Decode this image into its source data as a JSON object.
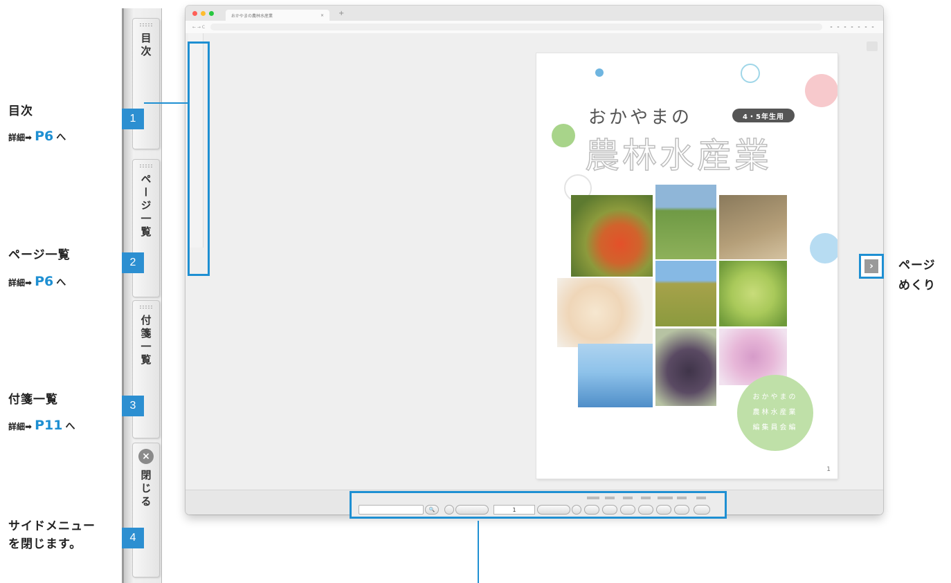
{
  "annotations": [
    {
      "number": "1",
      "title": "目次",
      "detail_prefix": "詳細➡",
      "page": "P6",
      "suffix": "へ"
    },
    {
      "number": "2",
      "title": "ページ一覧",
      "detail_prefix": "詳細➡",
      "page": "P6",
      "suffix": "へ"
    },
    {
      "number": "3",
      "title": "付箋一覧",
      "detail_prefix": "詳細➡",
      "page": "P11",
      "suffix": "へ"
    },
    {
      "number": "4",
      "title_line1": "サイドメニュー",
      "title_line2": "を閉じます。"
    }
  ],
  "side_menu": {
    "toc": "目次",
    "pages": "ページ一覧",
    "sticky": "付箋一覧",
    "close": "閉じる",
    "close_icon": "×"
  },
  "browser": {
    "tab_title": "おかやまの農林水産業",
    "tab_close": "×",
    "new_tab": "+",
    "nav_glyphs": "←  →  C"
  },
  "cover": {
    "subtitle": "おかやまの",
    "title": "農林水産業",
    "grade_badge": "4・5年生用",
    "editorial_line1": "おかやまの",
    "editorial_line2": "農林水産業",
    "editorial_line3": "編集員会編",
    "page_number": "1"
  },
  "page_turn": {
    "icon": "›",
    "label_line1": "ページ",
    "label_line2": "めくり"
  },
  "toolbar": {
    "search_icon": "🔍",
    "page_value": "1"
  },
  "colors": {
    "accent": "#1e8fd2",
    "badge": "#2c8fd1",
    "editorial_circle": "#bfe0a8"
  }
}
